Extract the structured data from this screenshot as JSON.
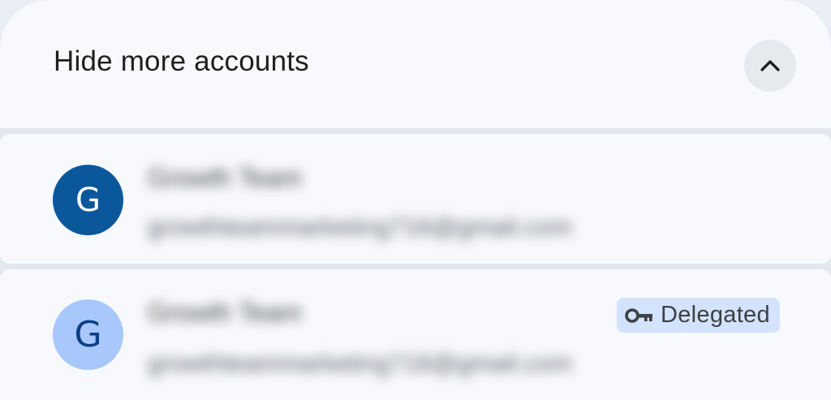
{
  "header": {
    "title": "Hide more accounts",
    "collapse_icon": "chevron-up-icon"
  },
  "accounts": [
    {
      "avatar_letter": "G",
      "avatar_color": "#0b579c",
      "name": "Growth Team",
      "email": "growthteammarketing716@gmail.com"
    },
    {
      "avatar_letter": "G",
      "avatar_color": "#a8c7fa",
      "name": "Growth Team",
      "email": "growthteammarketing716@gmail.com",
      "badge": {
        "icon": "key-icon",
        "label": "Delegated"
      }
    }
  ],
  "colors": {
    "header_bg": "#f7f9fc",
    "divider_bg": "#e3e8ef",
    "badge_bg": "#d3e3fd"
  }
}
